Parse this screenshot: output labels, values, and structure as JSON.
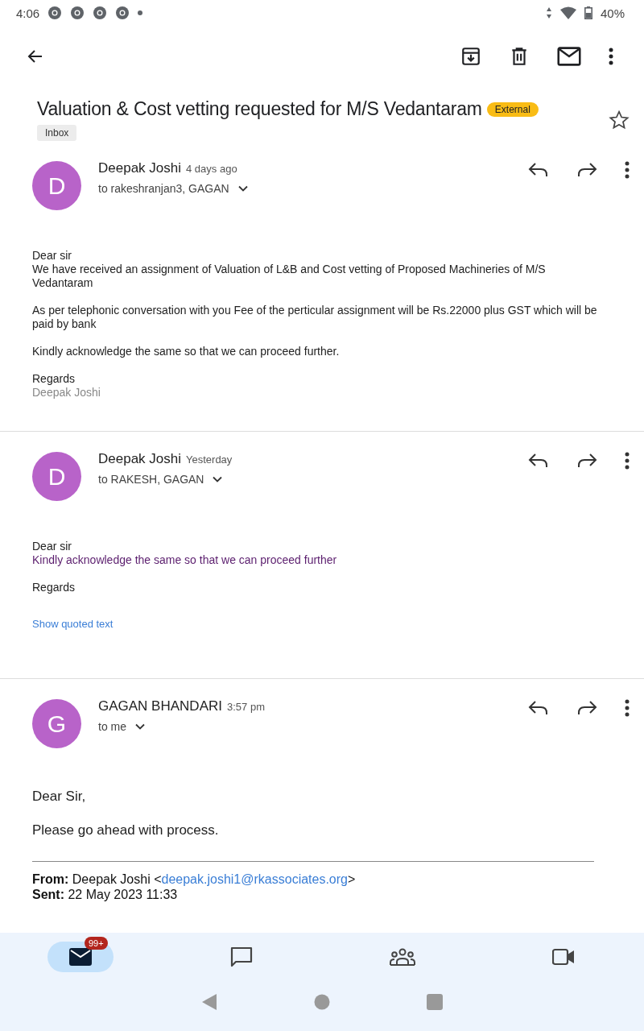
{
  "status_bar": {
    "time": "4:06",
    "notifications": [
      {
        "kind": "browser"
      },
      {
        "kind": "browser"
      },
      {
        "kind": "browser"
      },
      {
        "kind": "browser"
      }
    ],
    "battery": "40%"
  },
  "subject": {
    "title": "Valuation & Cost vetting requested for M/S Vedantaram",
    "tag": "External",
    "label": "Inbox",
    "starred": false
  },
  "messages": [
    {
      "avatar": "D",
      "color": "#b863c9",
      "sender": "Deepak Joshi",
      "time": "4 days ago",
      "recipients": "to rakeshranjan3, GAGAN",
      "paragraphs": [
        {
          "kind": "text",
          "lines": [
            "Dear sir",
            "We have received an assignment of Valuation of L&B and Cost vetting of Proposed Machineries of M/S Vedantaram"
          ]
        },
        {
          "kind": "text",
          "lines": [
            "As per telephonic conversation with you Fee of the perticular assignment will be Rs.22000 plus GST which will be paid by bank"
          ]
        },
        {
          "kind": "text",
          "lines": [
            "Kindly acknowledge the same so that we can proceed further."
          ]
        },
        {
          "kind": "text",
          "lines": [
            "Regards"
          ]
        },
        {
          "kind": "signature",
          "lines": [
            "Deepak Joshi"
          ]
        }
      ]
    },
    {
      "avatar": "D",
      "color": "#b863c9",
      "sender": "Deepak Joshi",
      "time": "Yesterday",
      "recipients": "to RAKESH, GAGAN",
      "paragraphs": [
        {
          "kind": "text",
          "lines": [
            "Dear sir"
          ]
        },
        {
          "kind": "quoted",
          "lines": [
            "Kindly acknowledge the same so that we can proceed further"
          ]
        },
        {
          "kind": "text",
          "lines": [
            "Regards"
          ]
        }
      ],
      "show_quoted": "Show quoted text"
    },
    {
      "avatar": "G",
      "color": "#b863c9",
      "sender": "GAGAN BHANDARI",
      "time": "3:57 pm",
      "recipients": "to me",
      "paragraphs": [
        {
          "kind": "large",
          "lines": [
            "Dear Sir,"
          ]
        },
        {
          "kind": "large",
          "lines": [
            "Please go ahead with process."
          ]
        }
      ],
      "forwarded": {
        "from_label": "From:",
        "from_name": "Deepak Joshi <",
        "email": "deepak.joshi1@rkassociates.org",
        "from_end": ">",
        "sent_label": "Sent:",
        "sent": "22 May 2023 11:33"
      }
    }
  ],
  "nav": [
    {
      "kind": "mail",
      "selected": true,
      "badge": "99+"
    },
    {
      "kind": "chat",
      "selected": false
    },
    {
      "kind": "spaces",
      "selected": false
    },
    {
      "kind": "video",
      "selected": false
    }
  ]
}
